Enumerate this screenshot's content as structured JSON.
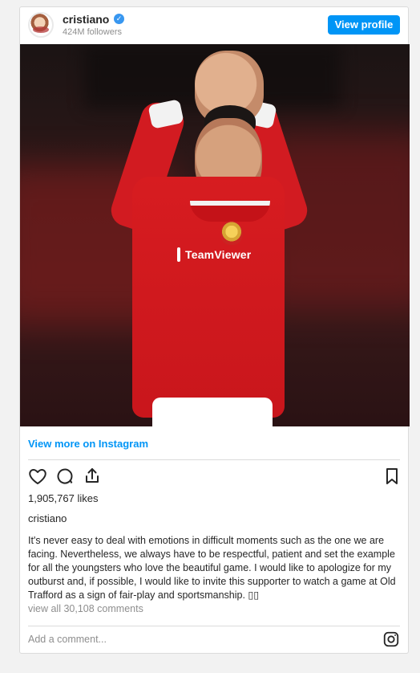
{
  "header": {
    "username": "cristiano",
    "followers": "424M followers",
    "view_profile_label": "View profile"
  },
  "post": {
    "view_more_label": "View more on Instagram",
    "likes": "1,905,767 likes",
    "caption_user": "cristiano",
    "caption_text": "It's never easy to deal with emotions in difficult moments such as the one we are facing. Nevertheless, we always have to be respectful, patient and set the example for all the youngsters who love the beautiful game. I would like to apologize for my outburst and, if possible, I would like to invite this supporter to watch a game at Old Trafford as a sign of fair-play and sportsmanship.",
    "comments_label": "view all 30,108 comments",
    "add_comment_placeholder": "Add a comment..."
  },
  "photo": {
    "sponsor_text": "TeamViewer"
  },
  "icons": {
    "verified": "verified-badge-icon",
    "like": "heart-icon",
    "comment": "comment-bubble-icon",
    "share": "share-icon",
    "save": "bookmark-icon",
    "instagram": "instagram-icon"
  },
  "colors": {
    "accent": "#0095f6",
    "muted": "#8e8e8e",
    "text": "#262626",
    "verified": "#3897f0"
  }
}
